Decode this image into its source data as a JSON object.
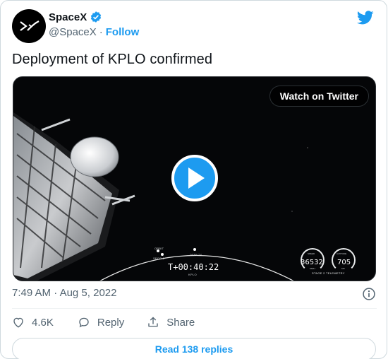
{
  "author": {
    "name": "SpaceX",
    "handle": "@SpaceX",
    "separator": "·",
    "follow_label": "Follow"
  },
  "tweet": {
    "text": "Deployment of KPLO confirmed"
  },
  "video": {
    "watch_label": "Watch on Twitter",
    "timer": "T+00:40:22",
    "mission": "KPLO",
    "timeline_events": [
      "ORBIT",
      "SECO-1",
      "DEPLOY"
    ],
    "speed_label": "SPEED",
    "speed_value": "36532",
    "speed_unit": "KM/H",
    "altitude_label": "ALTITUDE",
    "altitude_value": "705",
    "altitude_unit": "KM",
    "telemetry_label": "STAGE 2 TELEMETRY"
  },
  "meta": {
    "time": "7:49 AM",
    "date_sep": "·",
    "date": "Aug 5, 2022"
  },
  "actions": {
    "likes": "4.6K",
    "reply_label": "Reply",
    "share_label": "Share"
  },
  "replies_button": "Read 138 replies",
  "colors": {
    "accent": "#1d9bf0",
    "text": "#0f1419",
    "muted": "#536471",
    "border": "#cfd9de"
  },
  "icons": [
    "spacex-logo-icon",
    "verified-badge-icon",
    "twitter-bird-icon",
    "play-icon",
    "info-icon",
    "heart-icon",
    "reply-icon",
    "share-icon"
  ]
}
